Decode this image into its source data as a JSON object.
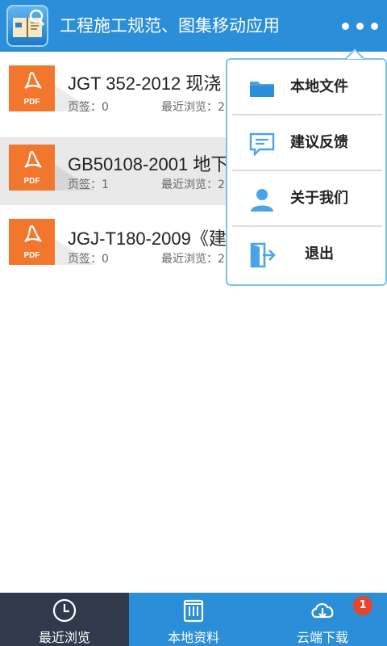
{
  "header": {
    "title": "工程施工规范、图集移动应用",
    "more_icon": "more-dots-icon"
  },
  "documents": [
    {
      "title": "JGT 352-2012 现浇",
      "bookmarks_label": "页签：0",
      "recent_label": "最近浏览：2"
    },
    {
      "title": "GB50108-2001 地下",
      "bookmarks_label": "页签：1",
      "recent_label": "最近浏览：2"
    },
    {
      "title": "JGJ-T180-2009《建",
      "bookmarks_label": "页签：0",
      "recent_label": "最近浏览：2"
    }
  ],
  "pdf_badge_label": "PDF",
  "popup_menu": {
    "items": [
      {
        "label": "本地文件",
        "icon": "folder-icon"
      },
      {
        "label": "建议反馈",
        "icon": "feedback-icon"
      },
      {
        "label": "关于我们",
        "icon": "user-icon"
      },
      {
        "label": "退出",
        "icon": "exit-icon"
      }
    ]
  },
  "bottom_nav": {
    "items": [
      {
        "label": "最近浏览",
        "icon": "clock-icon",
        "active": true
      },
      {
        "label": "本地资料",
        "icon": "book-icon",
        "active": false
      },
      {
        "label": "云端下载",
        "icon": "cloud-download-icon",
        "active": false,
        "badge": "1"
      }
    ]
  },
  "colors": {
    "primary": "#2b8ed8",
    "active_nav": "#2f3b4c",
    "pdf_orange": "#f2762b",
    "badge_red": "#e8432f",
    "menu_icon_blue": "#4aa3e6"
  }
}
